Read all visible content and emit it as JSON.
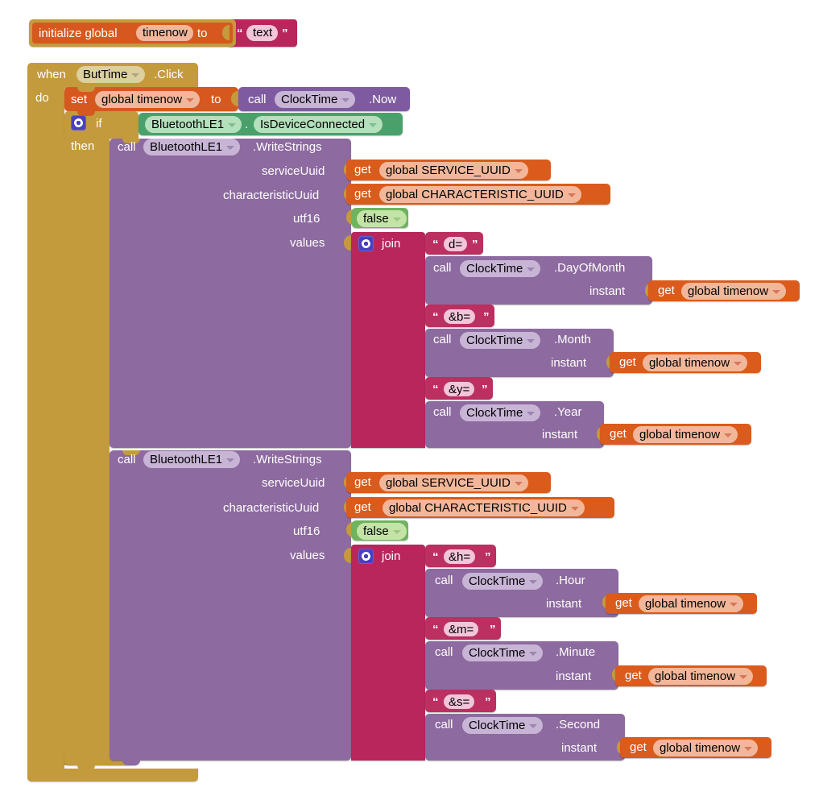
{
  "editor": {
    "name": "MIT App Inventor Blocks Editor",
    "background": "#ffffff"
  },
  "colors": {
    "variable_gold": "#c39b3c",
    "variable_orange": "#d6581f",
    "control_gold": "#b8a33f",
    "text_magenta": "#b8265c",
    "procedure_purple": "#7e5ba0",
    "logic_green": "#6fb35f",
    "component_green": "#4aa06b",
    "gear_blue": "#4b3fbe"
  },
  "blocks": {
    "init_global": {
      "keyword": "initialize global",
      "var_name": "timenow",
      "to": "to",
      "value_text": "text",
      "open_quote": "“",
      "close_quote": "”"
    },
    "event": {
      "when": "when",
      "component": "ButTime",
      "event_name": ".Click",
      "do": "do"
    },
    "set_statement": {
      "set": "set",
      "variable": "global timenow",
      "to": "to",
      "call": "call",
      "component": "ClockTime",
      "method": ".Now"
    },
    "if_block": {
      "gear": "gear-icon",
      "if": "if",
      "then": "then",
      "condition_component": "BluetoothLE1",
      "condition_dot": ".",
      "condition_property": "IsDeviceConnected"
    },
    "write_strings_1": {
      "call": "call",
      "component": "BluetoothLE1",
      "method": ".WriteStrings",
      "args": [
        {
          "label": "serviceUuid",
          "get": "get",
          "value": "global SERVICE_UUID"
        },
        {
          "label": "characteristicUuid",
          "get": "get",
          "value": "global CHARACTERISTIC_UUID"
        },
        {
          "label": "utf16",
          "value": "false"
        },
        {
          "label": "values"
        }
      ],
      "join": {
        "label": "join",
        "gear": "gear-icon",
        "items": [
          {
            "type": "text",
            "value": "d="
          },
          {
            "type": "call",
            "call": "call",
            "component": "ClockTime",
            "method": ".DayOfMonth",
            "arg_label": "instant",
            "get": "get",
            "arg_value": "global timenow"
          },
          {
            "type": "text",
            "value": "&b="
          },
          {
            "type": "call",
            "call": "call",
            "component": "ClockTime",
            "method": ".Month",
            "arg_label": "instant",
            "get": "get",
            "arg_value": "global timenow"
          },
          {
            "type": "text",
            "value": "&y="
          },
          {
            "type": "call",
            "call": "call",
            "component": "ClockTime",
            "method": ".Year",
            "arg_label": "instant",
            "get": "get",
            "arg_value": "global timenow"
          }
        ]
      }
    },
    "write_strings_2": {
      "call": "call",
      "component": "BluetoothLE1",
      "method": ".WriteStrings",
      "args": [
        {
          "label": "serviceUuid",
          "get": "get",
          "value": "global SERVICE_UUID"
        },
        {
          "label": "characteristicUuid",
          "get": "get",
          "value": "global CHARACTERISTIC_UUID"
        },
        {
          "label": "utf16",
          "value": "false"
        },
        {
          "label": "values"
        }
      ],
      "join": {
        "label": "join",
        "gear": "gear-icon",
        "items": [
          {
            "type": "text",
            "value": "&h="
          },
          {
            "type": "call",
            "call": "call",
            "component": "ClockTime",
            "method": ".Hour",
            "arg_label": "instant",
            "get": "get",
            "arg_value": "global timenow"
          },
          {
            "type": "text",
            "value": "&m="
          },
          {
            "type": "call",
            "call": "call",
            "component": "ClockTime",
            "method": ".Minute",
            "arg_label": "instant",
            "get": "get",
            "arg_value": "global timenow"
          },
          {
            "type": "text",
            "value": "&s="
          },
          {
            "type": "call",
            "call": "call",
            "component": "ClockTime",
            "method": ".Second",
            "arg_label": "instant",
            "get": "get",
            "arg_value": "global timenow"
          }
        ]
      }
    }
  }
}
